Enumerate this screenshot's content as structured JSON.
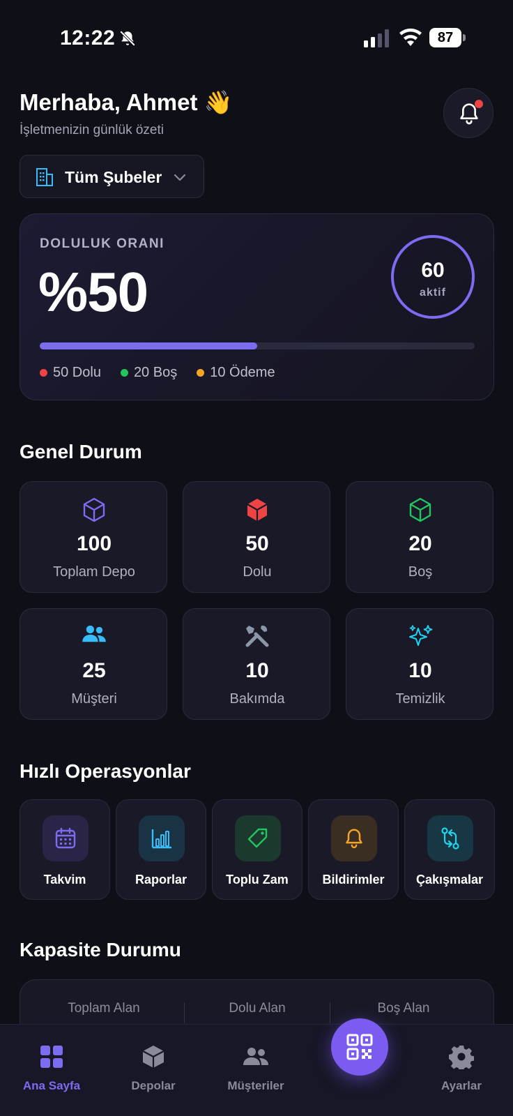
{
  "status_bar": {
    "time": "12:22",
    "battery": "87"
  },
  "header": {
    "greeting": "Merhaba, Ahmet 👋",
    "subtitle": "İşletmenizin günlük özeti"
  },
  "branch_selector": {
    "label": "Tüm Şubeler"
  },
  "occupancy": {
    "label": "DOLULUK ORANI",
    "value_text": "%50",
    "progress_percent": 50,
    "active_count": "60",
    "active_caption": "aktif",
    "legend": [
      {
        "text": "50 Dolu",
        "color": "#ef4444"
      },
      {
        "text": "20 Boş",
        "color": "#22c55e"
      },
      {
        "text": "10 Ödeme",
        "color": "#f5a524"
      }
    ]
  },
  "general_status": {
    "title": "Genel Durum",
    "cards": [
      {
        "value": "100",
        "label": "Toplam Depo",
        "icon": "cube-outline-icon",
        "color": "#7c6cf0"
      },
      {
        "value": "50",
        "label": "Dolu",
        "icon": "cube-solid-icon",
        "color": "#ef4444"
      },
      {
        "value": "20",
        "label": "Boş",
        "icon": "cube-outline-icon",
        "color": "#22c55e"
      },
      {
        "value": "25",
        "label": "Müşteri",
        "icon": "users-icon",
        "color": "#38bdf8"
      },
      {
        "value": "10",
        "label": "Bakımda",
        "icon": "tools-icon",
        "color": "#8b96a8"
      },
      {
        "value": "10",
        "label": "Temizlik",
        "icon": "sparkles-icon",
        "color": "#22d3ee"
      }
    ]
  },
  "quick_ops": {
    "title": "Hızlı Operasyonlar",
    "items": [
      {
        "label": "Takvim",
        "icon": "calendar-icon",
        "color": "#7c6cf0",
        "tile": "#2a2546"
      },
      {
        "label": "Raporlar",
        "icon": "bar-chart-icon",
        "color": "#38bdf8",
        "tile": "#1a3344"
      },
      {
        "label": "Toplu Zam",
        "icon": "tag-icon",
        "color": "#22c55e",
        "tile": "#1b3a2d"
      },
      {
        "label": "Bildirimler",
        "icon": "bell-icon",
        "color": "#f5a524",
        "tile": "#3a2e22"
      },
      {
        "label": "Çakışmalar",
        "icon": "swap-icon",
        "color": "#22d3ee",
        "tile": "#173745"
      }
    ]
  },
  "capacity": {
    "title": "Kapasite Durumu",
    "columns": [
      "Toplam Alan",
      "Dolu Alan",
      "Boş Alan"
    ]
  },
  "bottom_nav": {
    "items": [
      {
        "label": "Ana Sayfa",
        "icon": "grid-icon",
        "active": true
      },
      {
        "label": "Depolar",
        "icon": "box-icon"
      },
      {
        "label": "Müşteriler",
        "icon": "users-icon"
      },
      {
        "label": "Ayarlar",
        "icon": "gear-icon"
      }
    ]
  },
  "colors": {
    "accent": "#7c6cf0",
    "background": "#0f0f18"
  }
}
